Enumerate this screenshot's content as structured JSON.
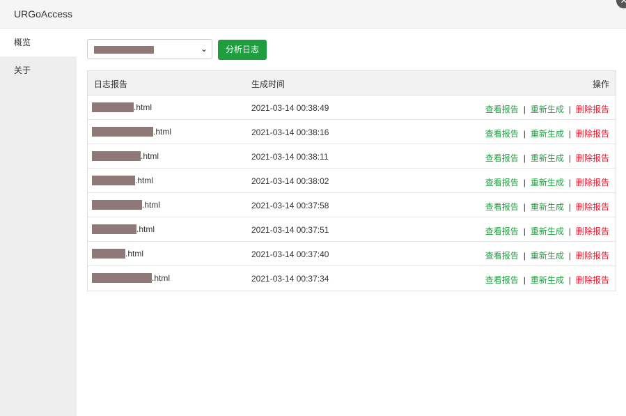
{
  "window": {
    "title": "URGoAccess",
    "close_glyph": "✕"
  },
  "sidebar": {
    "items": [
      {
        "label": "概览"
      },
      {
        "label": "关于"
      }
    ]
  },
  "toolbar": {
    "analyze_label": "分析日志",
    "select_arrow": "⌄"
  },
  "table": {
    "headers": {
      "name": "日志报告",
      "time": "生成时间",
      "ops": "操作"
    },
    "actions": {
      "view": "查看报告",
      "regen": "重新生成",
      "delete": "删除报告",
      "separator": "|"
    },
    "rows": [
      {
        "suffix": ".html",
        "time": "2021-03-14 00:38:49"
      },
      {
        "suffix": ".html",
        "time": "2021-03-14 00:38:16"
      },
      {
        "suffix": ".html",
        "time": "2021-03-14 00:38:11"
      },
      {
        "suffix": ".html",
        "time": "2021-03-14 00:38:02"
      },
      {
        "suffix": ".html",
        "time": "2021-03-14 00:37:58"
      },
      {
        "suffix": ".html",
        "time": "2021-03-14 00:37:51"
      },
      {
        "suffix": ".html",
        "time": "2021-03-14 00:37:40"
      },
      {
        "suffix": ".html",
        "time": "2021-03-14 00:37:34"
      }
    ]
  },
  "colors": {
    "accent": "#1e9e3f",
    "danger": "#e8142a",
    "redaction": "#8e7878"
  }
}
